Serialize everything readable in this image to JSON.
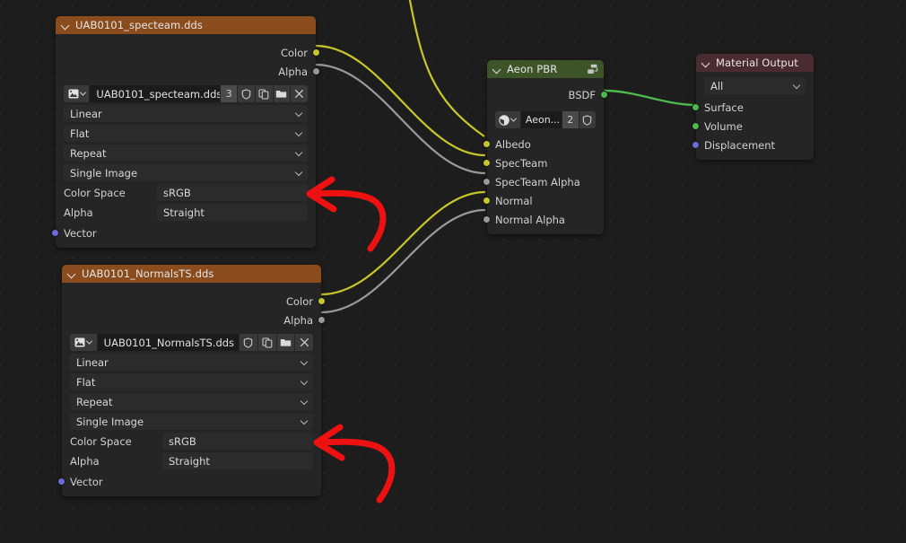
{
  "editor": {
    "name": "blender-shader-node-editor",
    "background_color": "#1d1d1d",
    "grid_dot_color": "#262626"
  },
  "nodes": [
    {
      "id": "tex_specteam",
      "title": "UAB0101_specteam.dds",
      "header_color": "#8a4c1c",
      "type": "Image Texture",
      "outputs": [
        {
          "label": "Color",
          "color": "#c7c729"
        },
        {
          "label": "Alpha",
          "color": "#9a9a9a"
        }
      ],
      "image": {
        "datablock_name": "UAB0101_specteam.dds",
        "users": "3",
        "browse_icon": "image-browse-icon",
        "fake_user_icon": "shield-icon",
        "new_icon": "duplicate-icon",
        "open_icon": "folder-icon",
        "unlink_icon": "close-icon"
      },
      "dropdowns": [
        {
          "name": "interpolation",
          "value": "Linear"
        },
        {
          "name": "projection",
          "value": "Flat"
        },
        {
          "name": "extension",
          "value": "Repeat"
        },
        {
          "name": "source",
          "value": "Single Image"
        }
      ],
      "properties": [
        {
          "label": "Color Space",
          "value": "sRGB"
        },
        {
          "label": "Alpha",
          "value": "Straight"
        }
      ],
      "inputs": [
        {
          "label": "Vector",
          "color": "#6b6bd8"
        }
      ]
    },
    {
      "id": "tex_normalsts",
      "title": "UAB0101_NormalsTS.dds",
      "header_color": "#8a4c1c",
      "type": "Image Texture",
      "outputs": [
        {
          "label": "Color",
          "color": "#c7c729"
        },
        {
          "label": "Alpha",
          "color": "#9a9a9a"
        }
      ],
      "image": {
        "datablock_name": "UAB0101_NormalsTS.dds",
        "users": "",
        "browse_icon": "image-browse-icon",
        "fake_user_icon": "shield-icon",
        "new_icon": "duplicate-icon",
        "open_icon": "folder-icon",
        "unlink_icon": "close-icon"
      },
      "dropdowns": [
        {
          "name": "interpolation",
          "value": "Linear"
        },
        {
          "name": "projection",
          "value": "Flat"
        },
        {
          "name": "extension",
          "value": "Repeat"
        },
        {
          "name": "source",
          "value": "Single Image"
        }
      ],
      "properties": [
        {
          "label": "Color Space",
          "value": "sRGB"
        },
        {
          "label": "Alpha",
          "value": "Straight"
        }
      ],
      "inputs": [
        {
          "label": "Vector",
          "color": "#6b6bd8"
        }
      ]
    },
    {
      "id": "aeon_pbr",
      "title": "Aeon PBR",
      "header_color": "#3d5428",
      "type": "Group",
      "header_icon": "node-group-icon",
      "outputs": [
        {
          "label": "BSDF",
          "color": "#4eb94e"
        }
      ],
      "group_datablock": {
        "browse_icon": "node-tree-browse-icon",
        "name": "Aeon...",
        "users": "2",
        "fake_user_icon": "shield-icon"
      },
      "inputs": [
        {
          "label": "Albedo",
          "color": "#c7c729"
        },
        {
          "label": "SpecTeam",
          "color": "#c7c729"
        },
        {
          "label": "SpecTeam Alpha",
          "color": "#9a9a9a"
        },
        {
          "label": "Normal",
          "color": "#c7c729"
        },
        {
          "label": "Normal Alpha",
          "color": "#9a9a9a"
        }
      ]
    },
    {
      "id": "material_output",
      "title": "Material Output",
      "header_color": "#4b2b32",
      "type": "Material Output",
      "target_dropdown": {
        "name": "target",
        "value": "All"
      },
      "inputs": [
        {
          "label": "Surface",
          "color": "#4eb94e"
        },
        {
          "label": "Volume",
          "color": "#4eb94e"
        },
        {
          "label": "Displacement",
          "color": "#6b6bd8"
        }
      ]
    }
  ],
  "links": [
    {
      "name": "specteam-color-to-specteam",
      "color": "#c7c729"
    },
    {
      "name": "specteam-alpha-to-specteam-alpha",
      "color": "#9a9a9a"
    },
    {
      "name": "offscreen-to-albedo",
      "color": "#c7c729"
    },
    {
      "name": "normalsts-color-to-normal",
      "color": "#c7c729"
    },
    {
      "name": "normalsts-alpha-to-normal-alpha",
      "color": "#9a9a9a"
    },
    {
      "name": "bsdf-to-surface",
      "color": "#4eb94e"
    }
  ],
  "annotations": [
    {
      "name": "arrow-to-color-space-specteam",
      "color": "#ee1111"
    },
    {
      "name": "arrow-to-color-space-normalsts",
      "color": "#ee1111"
    }
  ]
}
